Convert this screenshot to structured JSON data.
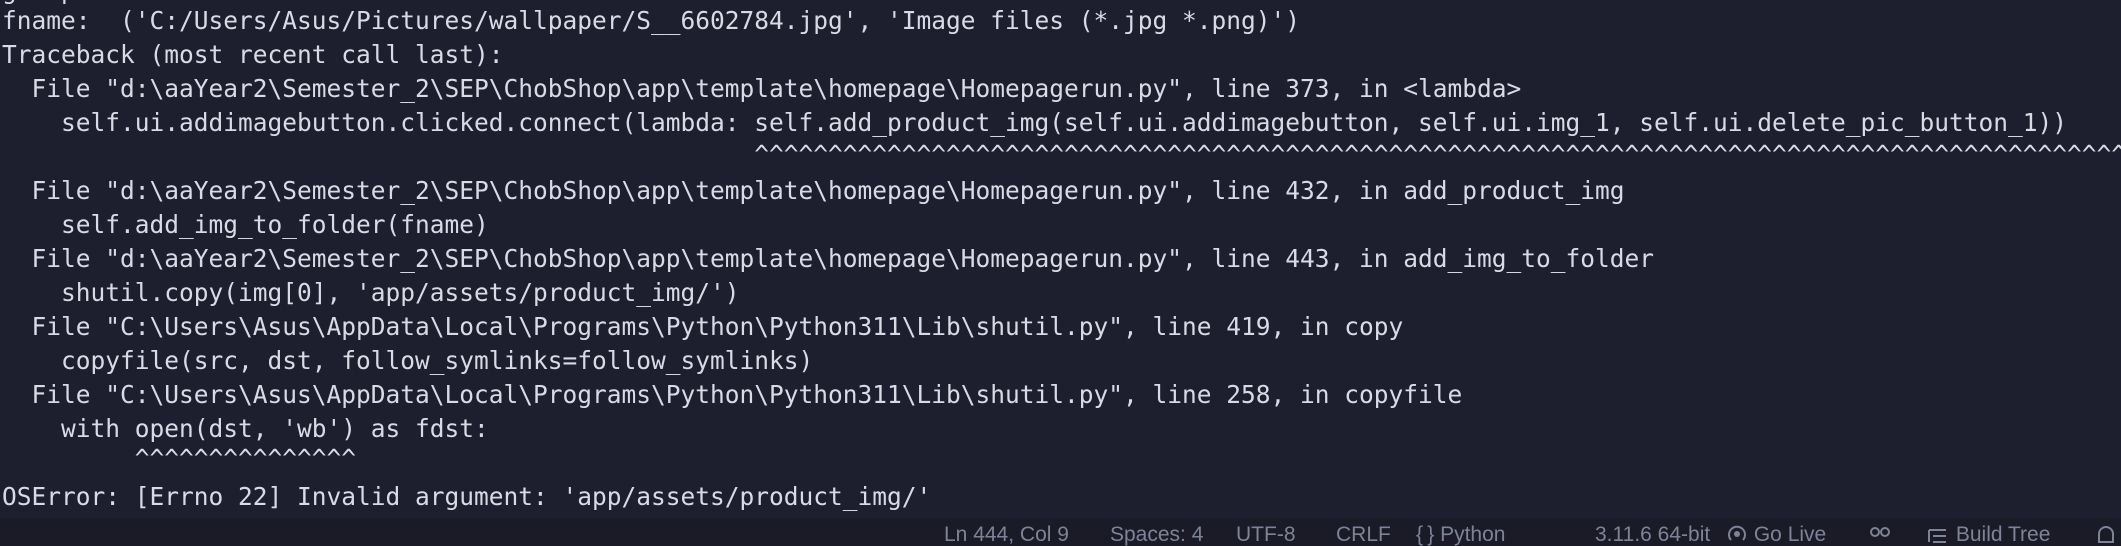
{
  "terminal": {
    "partial_top_line": "g   p",
    "lines": [
      "fname:  ('C:/Users/Asus/Pictures/wallpaper/S__6602784.jpg', 'Image files (*.jpg *.png)')",
      "Traceback (most recent call last):",
      "  File \"d:\\aaYear2\\Semester_2\\SEP\\ChobShop\\app\\template\\homepage\\Homepagerun.py\", line 373, in <lambda>",
      "    self.ui.addimagebutton.clicked.connect(lambda: self.add_product_img(self.ui.addimagebutton, self.ui.img_1, self.ui.delete_pic_button_1))",
      "                                                   ^^^^^^^^^^^^^^^^^^^^^^^^^^^^^^^^^^^^^^^^^^^^^^^^^^^^^^^^^^^^^^^^^^^^^^^^^^^^^^^^^^^^^^^^^^^^^",
      "  File \"d:\\aaYear2\\Semester_2\\SEP\\ChobShop\\app\\template\\homepage\\Homepagerun.py\", line 432, in add_product_img",
      "    self.add_img_to_folder(fname)",
      "  File \"d:\\aaYear2\\Semester_2\\SEP\\ChobShop\\app\\template\\homepage\\Homepagerun.py\", line 443, in add_img_to_folder",
      "    shutil.copy(img[0], 'app/assets/product_img/')",
      "  File \"C:\\Users\\Asus\\AppData\\Local\\Programs\\Python\\Python311\\Lib\\shutil.py\", line 419, in copy",
      "    copyfile(src, dst, follow_symlinks=follow_symlinks)",
      "  File \"C:\\Users\\Asus\\AppData\\Local\\Programs\\Python\\Python311\\Lib\\shutil.py\", line 258, in copyfile",
      "    with open(dst, 'wb') as fdst:",
      "         ^^^^^^^^^^^^^^^",
      "OSError: [Errno 22] Invalid argument: 'app/assets/product_img/'"
    ]
  },
  "statusbar": {
    "position": "Ln 444, Col 9",
    "spaces": "Spaces: 4",
    "encoding": "UTF-8",
    "eol": "CRLF",
    "language": "Python",
    "interpreter": "3.11.6 64-bit",
    "go_live": "Go Live",
    "build_tree": "Build Tree"
  },
  "colors": {
    "background": "#1e1f2e",
    "text": "#d8dbe6",
    "statusbar_bg": "#1a1b26",
    "statusbar_text": "#7f8398"
  },
  "icons": {
    "language": "braces-icon",
    "go_live": "broadcast-icon",
    "accounts": "accounts-icon",
    "build_tree": "list-tree-icon",
    "notifications": "bell-icon"
  }
}
